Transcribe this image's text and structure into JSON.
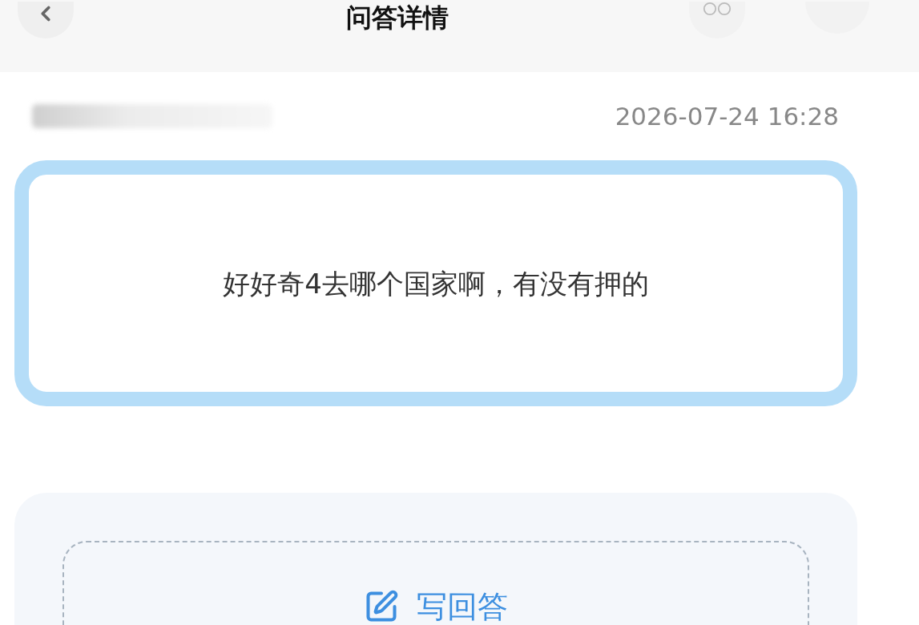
{
  "header": {
    "title": "问答详情"
  },
  "question": {
    "date": "2026-07-24 16:28",
    "text": "好好奇4去哪个国家啊，有没有押的"
  },
  "answer_panel": {
    "button": "写回答"
  }
}
